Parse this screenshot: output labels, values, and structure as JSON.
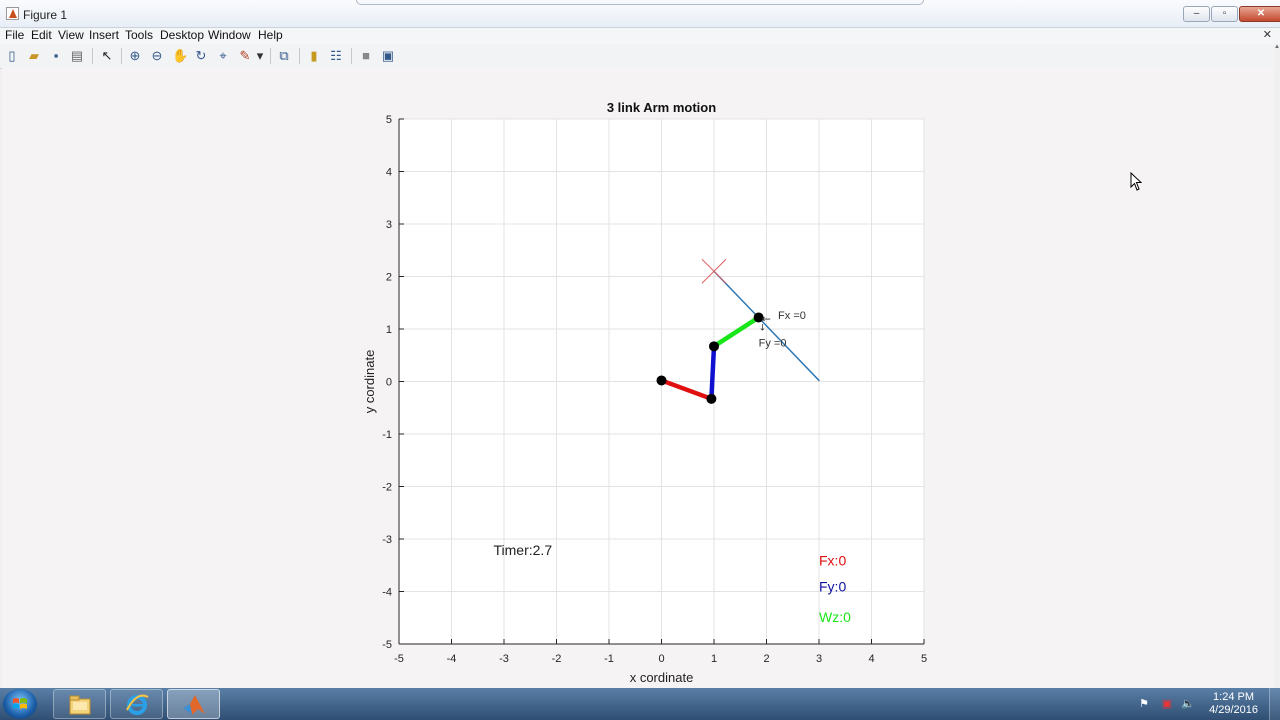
{
  "window": {
    "title": "Figure 1",
    "minimize_glyph": "‒",
    "maximize_glyph": "▫",
    "close_glyph": "✕",
    "doc_close_glyph": "✕"
  },
  "menu": [
    {
      "id": "file",
      "label": "File"
    },
    {
      "id": "edit",
      "label": "Edit"
    },
    {
      "id": "view",
      "label": "View"
    },
    {
      "id": "insert",
      "label": "Insert"
    },
    {
      "id": "tools",
      "label": "Tools"
    },
    {
      "id": "desktop",
      "label": "Desktop"
    },
    {
      "id": "window",
      "label": "Window"
    },
    {
      "id": "help",
      "label": "Help"
    }
  ],
  "toolbar": [
    {
      "icon": "new-figure-icon",
      "glyph": "▯"
    },
    {
      "icon": "open-file-icon",
      "glyph": "▰"
    },
    {
      "icon": "save-icon",
      "glyph": "▪"
    },
    {
      "icon": "print-icon",
      "glyph": "▤"
    },
    {
      "icon": "pointer-icon",
      "glyph": "↖"
    },
    {
      "icon": "zoom-in-icon",
      "glyph": "⊕"
    },
    {
      "icon": "zoom-out-icon",
      "glyph": "⊖"
    },
    {
      "icon": "pan-icon",
      "glyph": "✋"
    },
    {
      "icon": "rotate-3d-icon",
      "glyph": "↻"
    },
    {
      "icon": "data-cursor-icon",
      "glyph": "⌖"
    },
    {
      "icon": "brush-icon",
      "glyph": "✎"
    },
    {
      "icon": "brush-dropdown-icon",
      "glyph": "▾"
    },
    {
      "icon": "link-plot-icon",
      "glyph": "⧉"
    },
    {
      "icon": "insert-colorbar-icon",
      "glyph": "▮"
    },
    {
      "icon": "insert-legend-icon",
      "glyph": "☷"
    },
    {
      "icon": "hide-plot-tools-icon",
      "glyph": "■"
    },
    {
      "icon": "show-plot-tools-icon",
      "glyph": "▣"
    }
  ],
  "chart_data": {
    "type": "line",
    "title": "3 link Arm motion",
    "xlabel": "x cordinate",
    "ylabel": "y cordinate",
    "xlim": [
      -5,
      5
    ],
    "ylim": [
      -5,
      5
    ],
    "xticks": [
      "-5",
      "-4",
      "-3",
      "-2",
      "-1",
      "0",
      "1",
      "2",
      "3",
      "4",
      "5"
    ],
    "yticks": [
      "-5",
      "-4",
      "-3",
      "-2",
      "-1",
      "0",
      "1",
      "2",
      "3",
      "4",
      "5"
    ],
    "grid": true,
    "series": [
      {
        "role": "trajectory",
        "color": "#2f78b5",
        "x": [
          1.0,
          3.0
        ],
        "y": [
          2.1,
          0.02
        ]
      },
      {
        "role": "link-1",
        "color": "#e01010",
        "x": [
          0.0,
          0.95
        ],
        "y": [
          0.02,
          -0.33
        ]
      },
      {
        "role": "link-2",
        "color": "#1010d0",
        "x": [
          0.95,
          1.0
        ],
        "y": [
          -0.33,
          0.67
        ]
      },
      {
        "role": "link-3",
        "color": "#19e619",
        "x": [
          1.0,
          1.85
        ],
        "y": [
          0.67,
          1.22
        ]
      }
    ],
    "joints": {
      "x": [
        0.0,
        0.95,
        1.0,
        1.85
      ],
      "y": [
        0.02,
        -0.33,
        0.67,
        1.22
      ]
    },
    "target": {
      "x": 1.0,
      "y": 2.1,
      "color": "#e06060"
    },
    "annotations": [
      {
        "text": "Fx =0",
        "x": 2.22,
        "y": 1.19,
        "color": "#333333",
        "size": 11
      },
      {
        "text": "Fy =0",
        "x": 1.85,
        "y": 0.67,
        "color": "#333333",
        "size": 11
      },
      {
        "text": "Timer:2.7",
        "x": -3.2,
        "y": -3.3,
        "color": "#222222",
        "size": 14
      },
      {
        "text": "Fx:0",
        "x": 3.0,
        "y": -3.5,
        "color": "#e01010",
        "size": 14
      },
      {
        "text": "Fy:0",
        "x": 3.0,
        "y": -4.0,
        "color": "#1010a0",
        "size": 14
      },
      {
        "text": "Wz:0",
        "x": 3.0,
        "y": -4.58,
        "color": "#19e619",
        "size": 14
      }
    ],
    "force_marker_glyph": "←",
    "force_marker_sub_glyph": "↓"
  },
  "taskbar": {
    "items": [
      {
        "icon": "windows-explorer-icon",
        "active": false
      },
      {
        "icon": "internet-explorer-icon",
        "active": false
      },
      {
        "icon": "matlab-icon",
        "active": true
      }
    ],
    "tray": {
      "time": "1:24 PM",
      "date": "4/29/2016",
      "flag_glyph": "⚑",
      "network_glyph": "▣",
      "volume_glyph": "🔈"
    }
  }
}
